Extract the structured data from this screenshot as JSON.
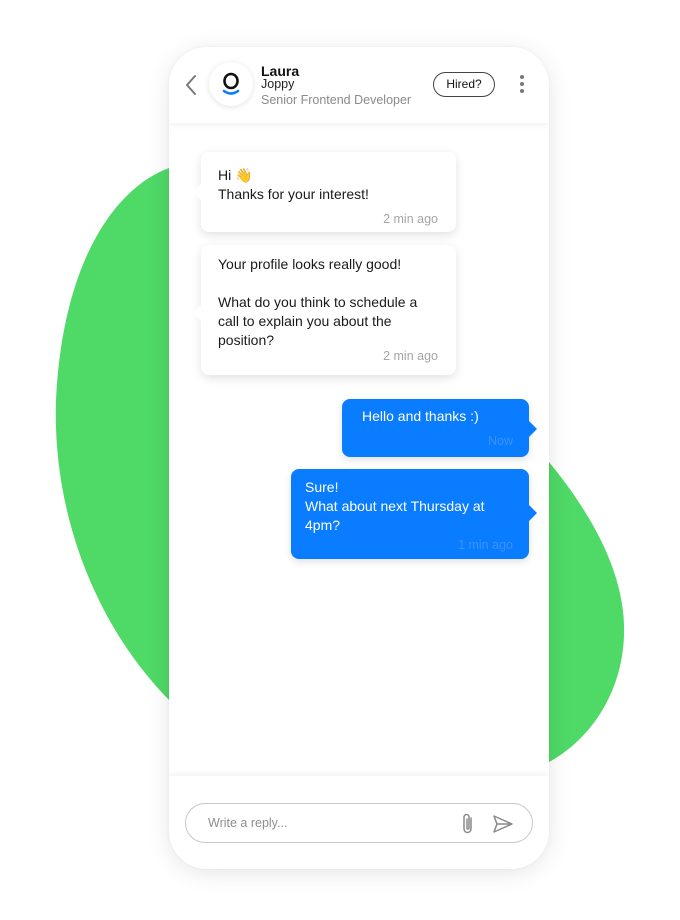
{
  "colors": {
    "accent": "#0a7cff",
    "blob": "#4fd966",
    "avatar_brand": "#0a7cff"
  },
  "header": {
    "back_icon": "chevron-left-icon",
    "contact_name": "Laura",
    "company": "Joppy",
    "role": "Senior Frontend Developer",
    "hired_label": "Hired?",
    "more_icon": "more-vertical-icon"
  },
  "messages": [
    {
      "direction": "incoming",
      "text": "Hi 👋\nThanks for your interest!",
      "time": "2 min ago"
    },
    {
      "direction": "incoming",
      "text": "Your profile looks really good!\n\nWhat do you think to schedule a\ncall to explain you about the\nposition?",
      "time": "2 min ago"
    },
    {
      "direction": "outgoing",
      "text": "Hello and thanks :)",
      "time": "Now"
    },
    {
      "direction": "outgoing",
      "text": "Sure!\nWhat about next Thursday at\n4pm?",
      "time": "1 min ago"
    }
  ],
  "composer": {
    "placeholder": "Write a reply...",
    "value": "",
    "attach_icon": "paperclip-icon",
    "send_icon": "send-icon"
  }
}
